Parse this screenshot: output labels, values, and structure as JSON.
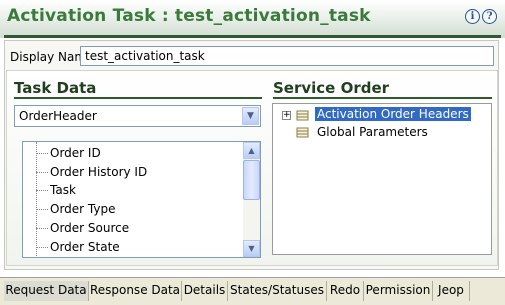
{
  "header": {
    "title": "Activation Task : test_activation_task",
    "icons": [
      "info-icon",
      "help-icon"
    ]
  },
  "display": {
    "label": "Display Nam",
    "value": "test_activation_task"
  },
  "task_data": {
    "title": "Task Data",
    "selected": "OrderHeader",
    "items": [
      "Order ID",
      "Order History ID",
      "Task",
      "Order Type",
      "Order Source",
      "Order State"
    ]
  },
  "service_order": {
    "title": "Service Order",
    "nodes": [
      {
        "label": "Activation Order Headers",
        "selected": true,
        "expander": "+"
      },
      {
        "label": "Global Parameters",
        "selected": false,
        "expander": ""
      }
    ]
  },
  "tabs": [
    "Request Data",
    "Response Data",
    "Details",
    "States/Statuses",
    "Redo",
    "Permission",
    "Jeop"
  ],
  "colors": {
    "title_green": "#3a7a3a",
    "selection_blue": "#316ac5"
  }
}
